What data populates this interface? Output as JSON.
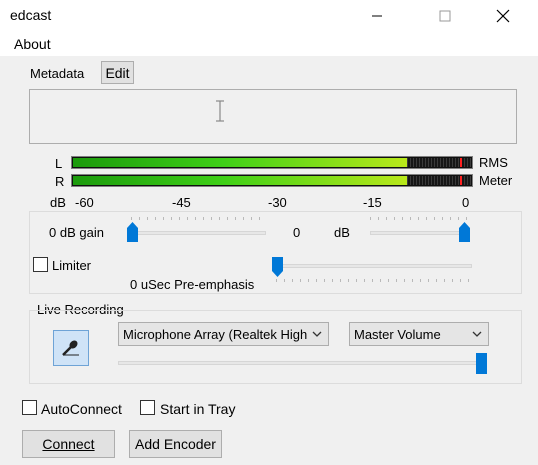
{
  "window": {
    "title": "edcast",
    "minimize": "minimize",
    "maximize": "maximize",
    "close": "close"
  },
  "menu": {
    "about": "About"
  },
  "metadata": {
    "label": "Metadata",
    "edit_button": "Edit",
    "text_value": ""
  },
  "meter": {
    "left_channel": "L",
    "right_channel": "R",
    "rms_label": "RMS",
    "meter_label": "Meter",
    "db_label": "dB",
    "scale": [
      "-60",
      "-45",
      "-30",
      "-15",
      "0"
    ],
    "level_fraction": 0.84,
    "colors": {
      "low": "#1b9a0c",
      "mid": "#3fd017",
      "high": "#b9e81a",
      "peak": "#ff2020"
    }
  },
  "gain": {
    "value_text": "0  dB gain",
    "center_value": "0",
    "unit": "dB",
    "gain_level": 0.0,
    "right_level": 1.0
  },
  "limiter": {
    "label": "Limiter",
    "checked": false
  },
  "preemphasis": {
    "text": "0  uSec Pre-emphasis",
    "level": 0.0
  },
  "live_recording": {
    "label": "Live Recording",
    "device": "Microphone Array (Realtek High",
    "volume_control": "Master Volume",
    "volume_level": 1.0,
    "mic_icon": "microphone-icon"
  },
  "options": {
    "autoconnect": {
      "label": "AutoConnect",
      "checked": false
    },
    "start_in_tray": {
      "label": "Start in Tray",
      "checked": false
    }
  },
  "actions": {
    "connect": "Connect",
    "add_encoder": "Add Encoder"
  },
  "accent_color": "#0078d7"
}
